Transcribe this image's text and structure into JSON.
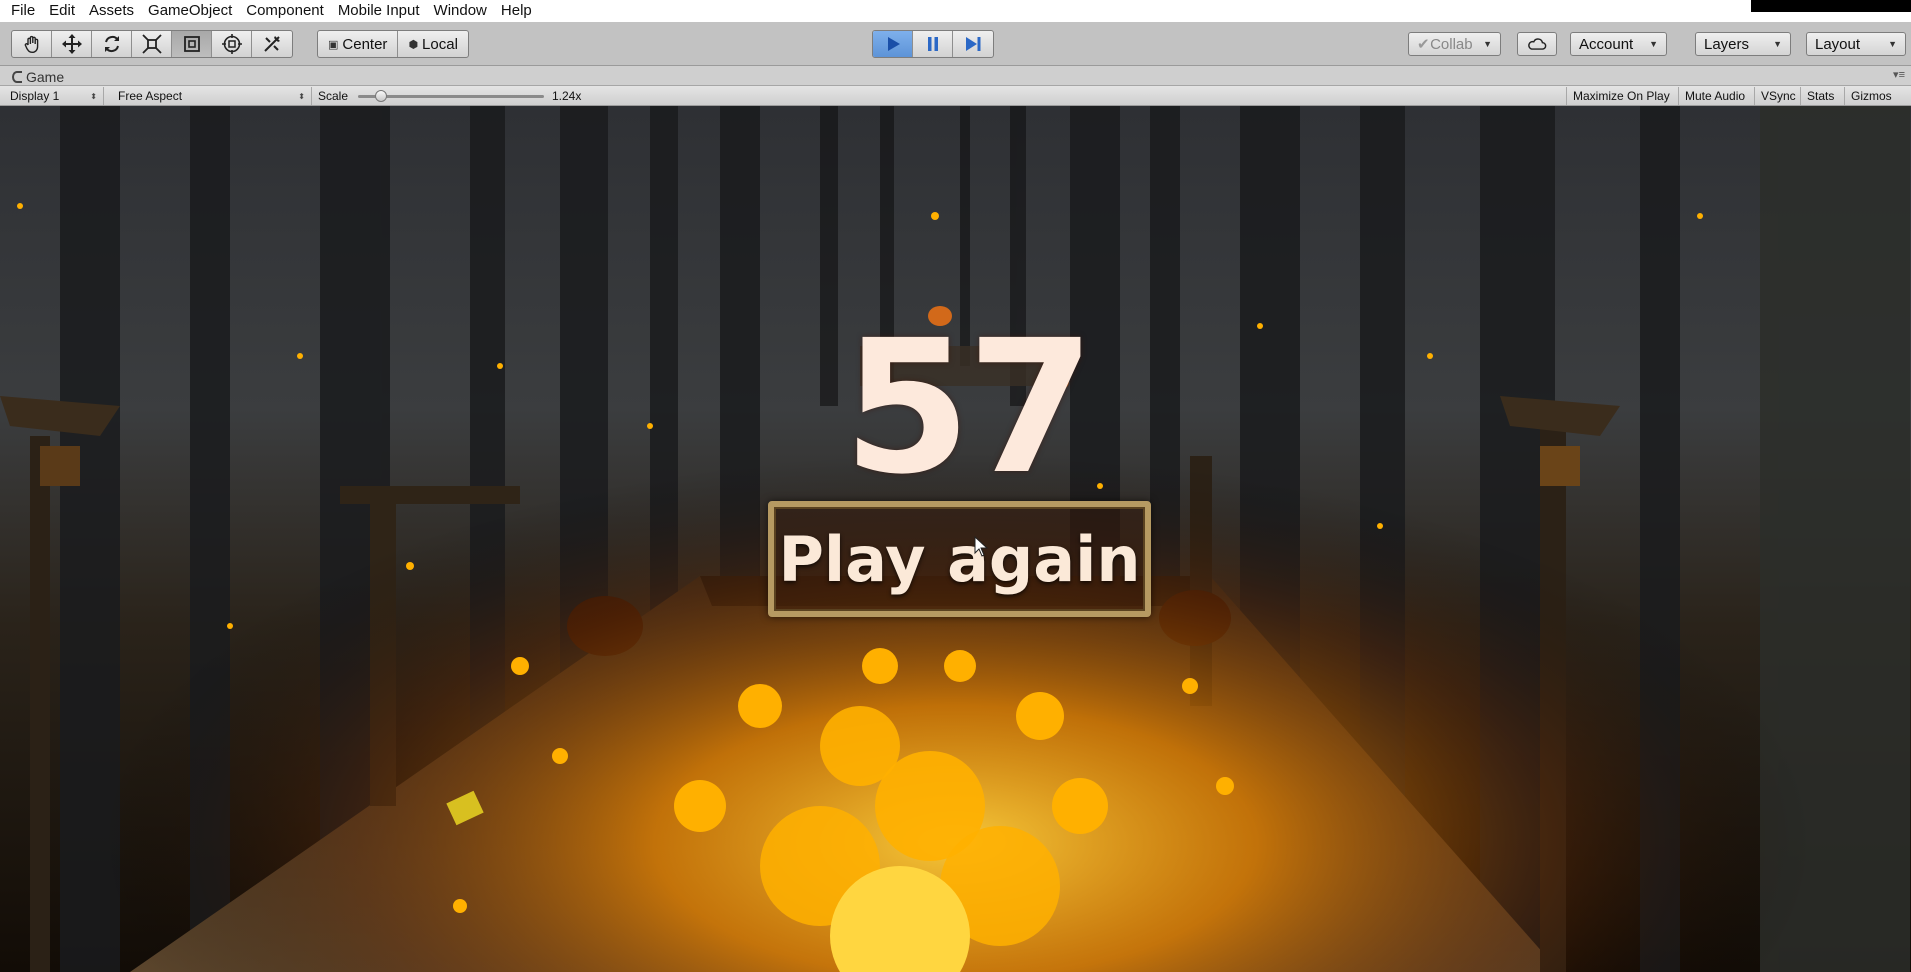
{
  "menu": [
    "File",
    "Edit",
    "Assets",
    "GameObject",
    "Component",
    "Mobile Input",
    "Window",
    "Help"
  ],
  "toolbar": {
    "tools": [
      "hand-tool-icon",
      "move-tool-icon",
      "rotate-tool-icon",
      "scale-tool-icon",
      "rect-tool-icon",
      "transform-tool-icon",
      "custom-tool-icon"
    ],
    "active_tool": "rect-tool-icon",
    "pivot_mode": "Center",
    "pivot_rotation": "Local",
    "playback": [
      "play-icon",
      "pause-icon",
      "step-icon"
    ],
    "collab_label": "Collab",
    "account_label": "Account",
    "layers_label": "Layers",
    "layout_label": "Layout"
  },
  "tab": {
    "title": "Game"
  },
  "gamebar": {
    "display": "Display 1",
    "aspect": "Free Aspect",
    "scale_label": "Scale",
    "scale_value": "1.24x",
    "maximize_on_play": "Maximize On Play",
    "mute_audio": "Mute Audio",
    "vsync": "VSync",
    "stats": "Stats",
    "gizmos": "Gizmos"
  },
  "game": {
    "score": "57",
    "play_again_label": "Play again"
  },
  "colors": {
    "play_active": "#6ea3e4",
    "score_text": "#fde9dc",
    "button_border": "#b69a62",
    "fire": "#ffb000"
  }
}
